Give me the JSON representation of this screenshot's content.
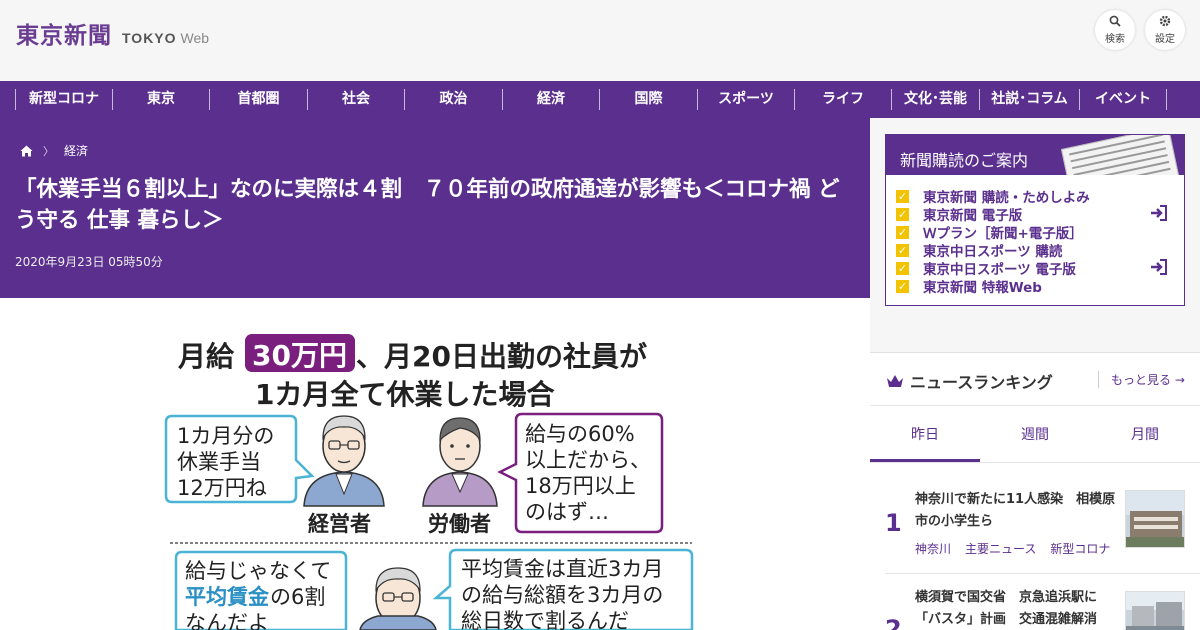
{
  "header": {
    "logo_main": "東京新聞",
    "logo_sub1": "TOKYO",
    "logo_sub2": "Web",
    "search_label": "検索",
    "settings_label": "設定"
  },
  "nav": {
    "items": [
      "新型コロナ",
      "東京",
      "首都圏",
      "社会",
      "政治",
      "経済",
      "国際",
      "スポーツ",
      "ライフ",
      "文化･芸能",
      "社説･コラム",
      "イベント"
    ]
  },
  "article": {
    "breadcrumb_section": "経済",
    "title": "「休業手当６割以上」なのに実際は４割　７０年前の政府通達が影響も＜コロナ禍 どう守る 仕事 暮らし＞",
    "date": "2020年9月23日 05時50分"
  },
  "illustration": {
    "headline1_pre": "月給",
    "headline1_amount": "30万円",
    "headline1_post": "、月20日出勤の社員が",
    "headline2": "1カ月全て休業した場合",
    "bubble_left": [
      "1カ月分の",
      "休業手当",
      "12万円ね"
    ],
    "bubble_right": [
      "給与の60%",
      "以上だから、",
      "18万円以上",
      "のはず…"
    ],
    "label_manager": "経営者",
    "label_worker": "労働者",
    "bubble_bottom_left_1": "給与じゃなくて",
    "bubble_bottom_left_2_hl": "平均賃金",
    "bubble_bottom_left_2_rest": "の6割",
    "bubble_bottom_left_3": "なんだよ",
    "bubble_bottom_right": [
      "平均賃金は直近3カ月",
      "の給与総額を3カ月の",
      "総日数で割るんだ"
    ]
  },
  "subscription": {
    "title": "新聞購読のご案内",
    "items": [
      "東京新聞 購読・ためしよみ",
      "東京新聞 電子版",
      "Ｗプラン［新聞+電子版］",
      "東京中日スポーツ 購読",
      "東京中日スポーツ 電子版",
      "東京新聞 特報Web"
    ]
  },
  "ranking": {
    "title": "ニュースランキング",
    "more_label": "もっと見る",
    "tabs": [
      "昨日",
      "週間",
      "月間"
    ],
    "items": [
      {
        "rank": "1",
        "title": "神奈川で新たに11人感染　相模原市の小学生ら",
        "tags": [
          "神奈川",
          "主要ニュース",
          "新型コロナ"
        ]
      },
      {
        "rank": "2",
        "title": "横須賀で国交省　京急追浜駅に「バスタ」計画　交通混雑解消",
        "tags": []
      }
    ]
  },
  "colors": {
    "brand": "#5b2f8e",
    "accent_check": "#f2c300"
  }
}
